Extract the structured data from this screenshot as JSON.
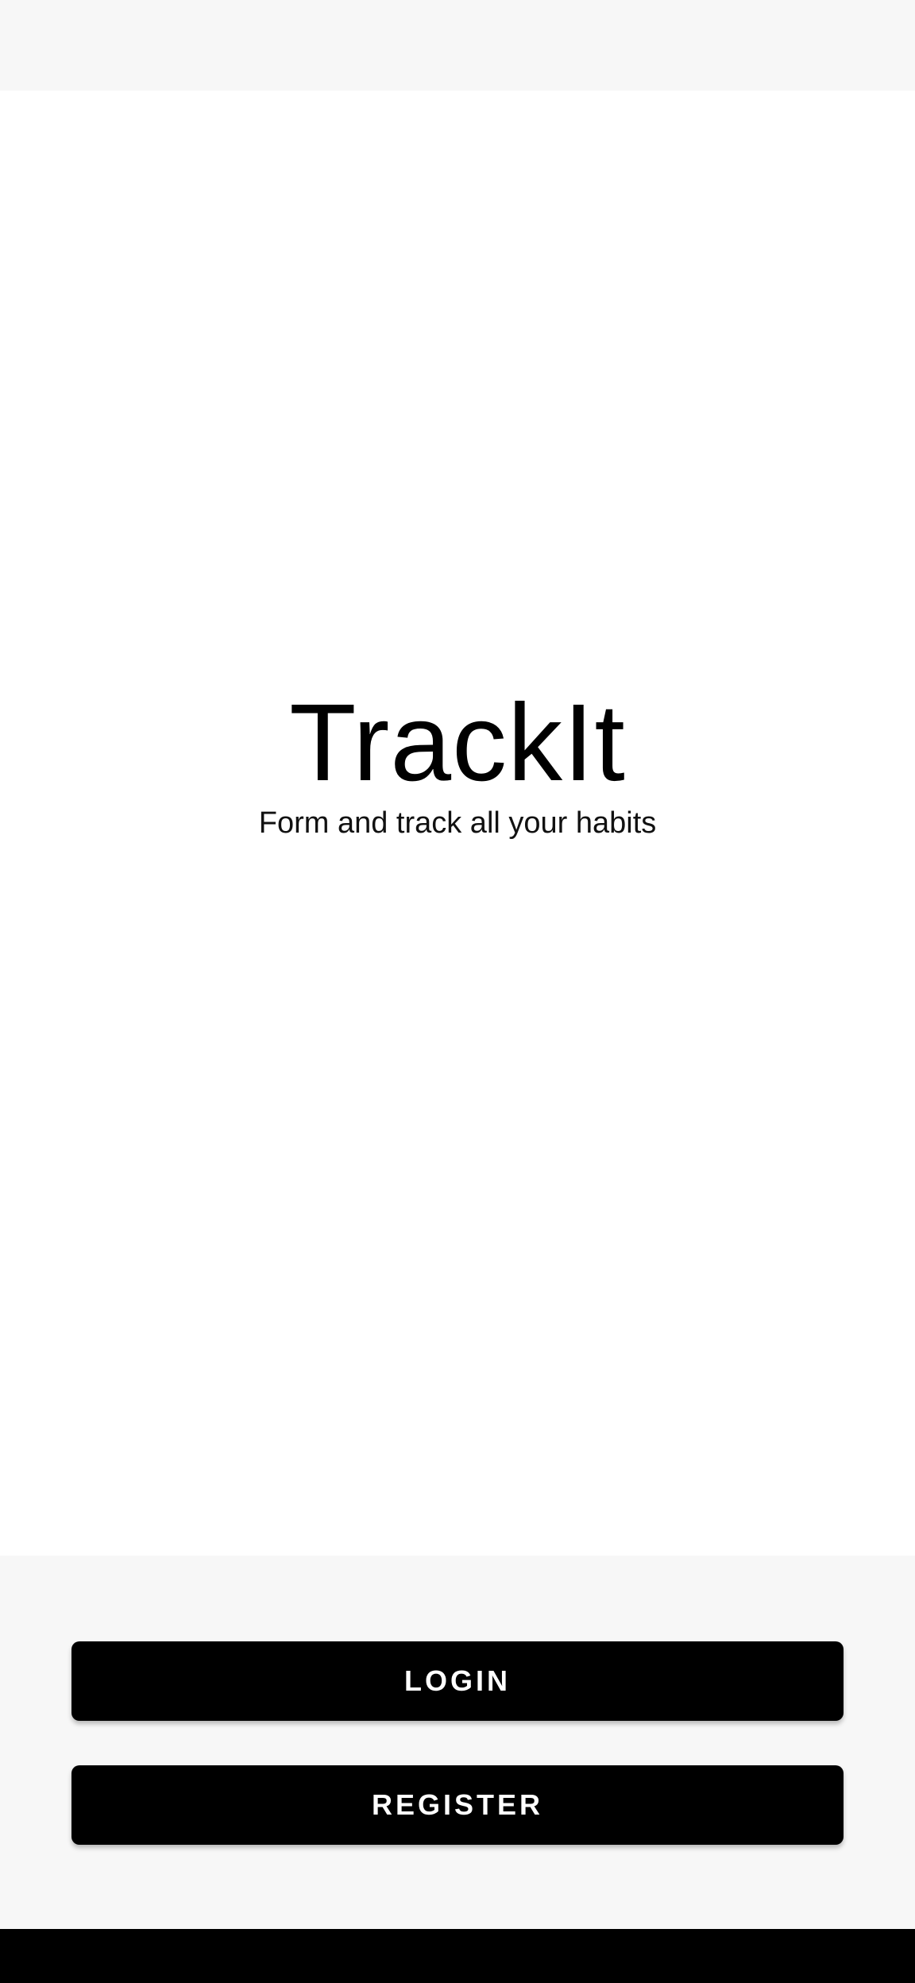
{
  "app": {
    "title": "TrackIt",
    "tagline": "Form and track all your habits"
  },
  "actions": {
    "login_label": "LOGIN",
    "register_label": "REGISTER"
  },
  "colors": {
    "background": "#ffffff",
    "panel": "#f7f7f7",
    "button_bg": "#000000",
    "button_text": "#ffffff",
    "nav_bar": "#000000"
  }
}
